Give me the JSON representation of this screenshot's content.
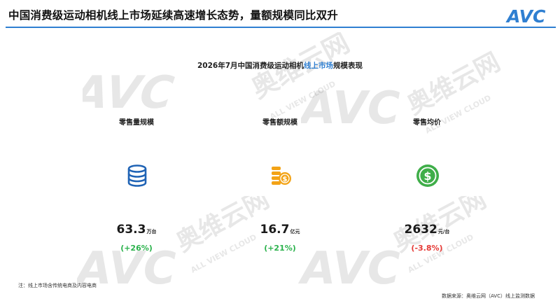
{
  "header": {
    "title": "中国消费级运动相机线上市场延续高速增长态势，量额规模同比双升",
    "logo_text": "AVC",
    "accent_color": "#2f7fd1"
  },
  "watermark": {
    "logo": "AVC",
    "cn": "奥维云网",
    "en": "ALL VIEW CLOUD"
  },
  "subtitle": {
    "prefix": "2026年7月中国消费级运动相机",
    "highlight": "线上市场",
    "suffix": "规模表现"
  },
  "metrics": [
    {
      "label": "零售量规模",
      "icon": "database-icon",
      "value": "63.3",
      "unit": "万台",
      "change": "(+26%)",
      "change_color": "#2bb24c"
    },
    {
      "label": "零售额规模",
      "icon": "coins-icon",
      "value": "16.7",
      "unit": "亿元",
      "change": "(+21%)",
      "change_color": "#2bb24c"
    },
    {
      "label": "零售均价",
      "icon": "dollar-icon",
      "value": "2632",
      "unit": "元/台",
      "change": "(-3.8%)",
      "change_color": "#e53935"
    }
  ],
  "footer": {
    "note": "注：线上市场含传统电商及内容电商",
    "source": "数据来源：奥维云网（AVC）线上监测数据"
  },
  "colors": {
    "blue": "#2f7fd1",
    "icon_blue": "#1f63b5",
    "orange": "#f3a316",
    "green": "#3fae49",
    "up": "#2bb24c",
    "down": "#e53935"
  }
}
